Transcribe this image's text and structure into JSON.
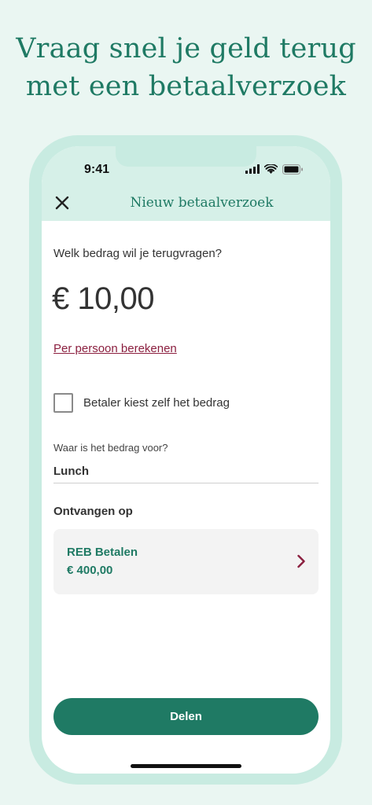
{
  "promo": {
    "headline_line1": "Vraag snel je geld terug",
    "headline_line2": "met een betaalverzoek"
  },
  "status_bar": {
    "time": "9:41",
    "icons": [
      "signal-icon",
      "wifi-icon",
      "battery-icon"
    ]
  },
  "header": {
    "close_icon": "close-icon",
    "title": "Nieuw betaalverzoek"
  },
  "form": {
    "amount_label": "Welk bedrag wil je terugvragen?",
    "amount_value": "€ 10,00",
    "per_person_link": "Per persoon berekenen",
    "payer_chooses_label": "Betaler kiest zelf het bedrag",
    "payer_chooses_checked": false,
    "description_label": "Waar is het bedrag voor?",
    "description_value": "Lunch",
    "receive_label": "Ontvangen op",
    "account": {
      "name": "REB Betalen",
      "balance": "€ 400,00",
      "chevron_icon": "chevron-right-icon"
    }
  },
  "actions": {
    "share_label": "Delen"
  },
  "colors": {
    "brand_green": "#1f7a64",
    "link_red": "#8b1f3f",
    "background_mint": "#eaf6f2",
    "header_mint": "#d6f0e8"
  }
}
